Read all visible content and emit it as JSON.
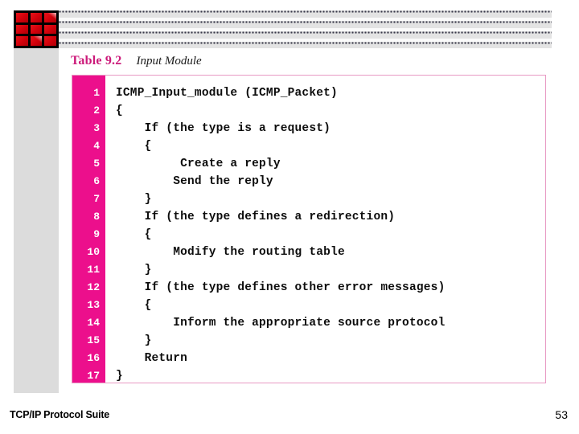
{
  "slide": {
    "footer_title": "TCP/IP Protocol Suite",
    "page_number": "53"
  },
  "logo": {
    "name": "red-grid-logo",
    "cells": 9,
    "colors": {
      "tile": "#d1000a",
      "background": "#000000"
    }
  },
  "header": {
    "banner_name": "dotted-pattern-banner",
    "colors": {
      "band": "#e3e3e3",
      "dot": "#3a3a4a"
    }
  },
  "caption": {
    "label": "Table 9.2",
    "title": "Input Module",
    "label_color": "#cc1a7a"
  },
  "code_table": {
    "accent_color": "#ec0f8c",
    "border_color": "#e89ac4",
    "line_numbers": [
      "1",
      "2",
      "3",
      "4",
      "5",
      "6",
      "7",
      "8",
      "9",
      "10",
      "11",
      "12",
      "13",
      "14",
      "15",
      "16",
      "17"
    ],
    "lines": [
      "ICMP_Input_module (ICMP_Packet)",
      "{",
      "    If (the type is a request)",
      "    {",
      "         Create a reply",
      "        Send the reply",
      "    }",
      "    If (the type defines a redirection)",
      "    {",
      "        Modify the routing table",
      "    }",
      "    If (the type defines other error messages)",
      "    {",
      "        Inform the appropriate source protocol",
      "    }",
      "    Return",
      "}"
    ]
  }
}
